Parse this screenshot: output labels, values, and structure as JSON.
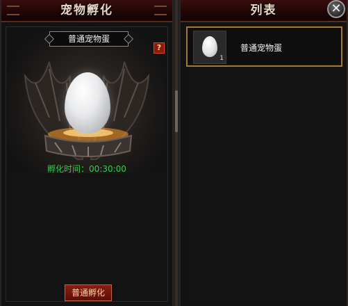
{
  "left_panel": {
    "title": "宠物孵化",
    "egg_name": "普通宠物蛋",
    "help_label": "?",
    "timer_label": "孵化时间：",
    "timer_value": "00:30:00",
    "hatch_button_label": "普通孵化"
  },
  "right_panel": {
    "title": "列表",
    "close_label": "✕",
    "items": [
      {
        "name": "普通宠物蛋",
        "count": "1",
        "icon": "pet-egg-icon"
      }
    ]
  },
  "colors": {
    "timer": "#2fd14a",
    "selected_border": "#a67a36",
    "title_bar": "#3a0d0d"
  }
}
